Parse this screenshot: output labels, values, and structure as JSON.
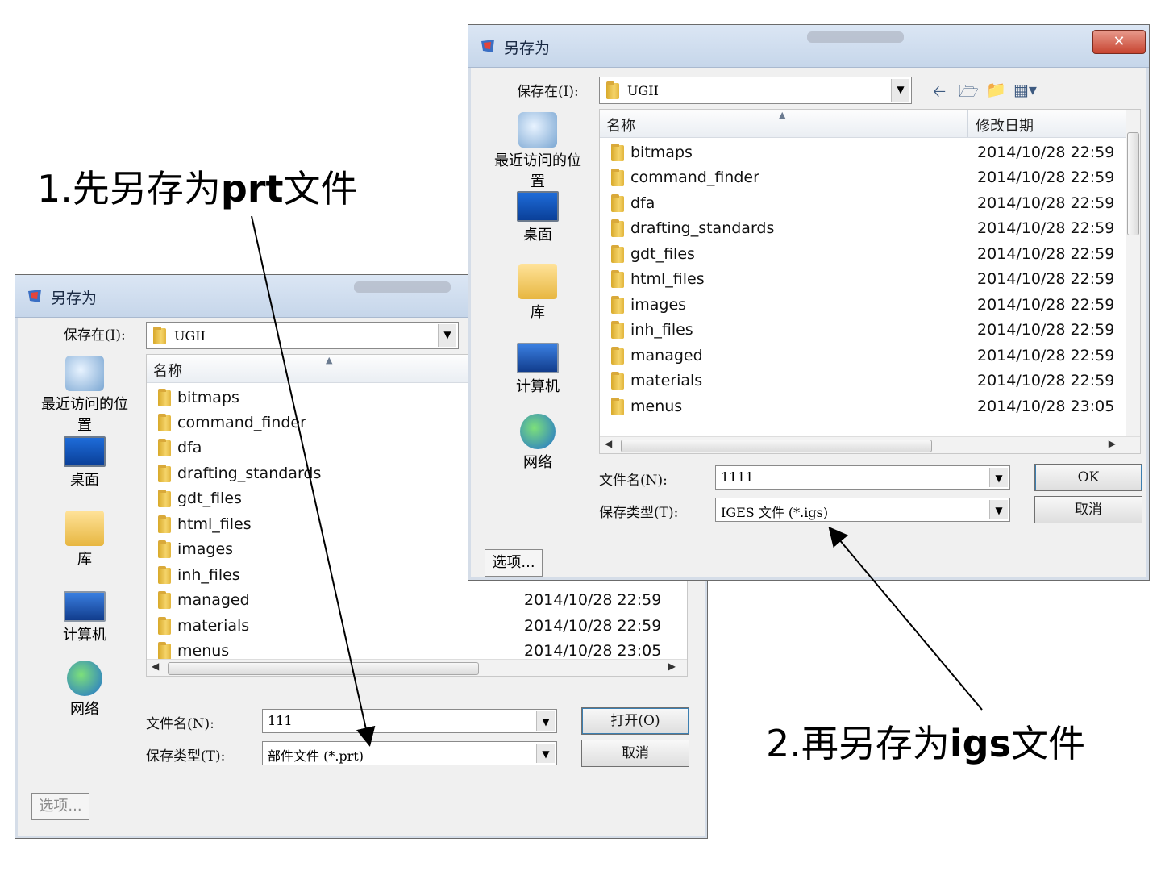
{
  "annotations": {
    "step1": {
      "prefix": "1.先另存为",
      "bold": "prt",
      "suffix": "文件"
    },
    "step2": {
      "prefix": "2.再另存为",
      "bold": "igs",
      "suffix": "文件"
    }
  },
  "dialog_back": {
    "title": "另存为",
    "save_in_label": "保存在(I):",
    "save_in_value": "UGII",
    "places": [
      "最近访问的位置",
      "桌面",
      "库",
      "计算机",
      "网络"
    ],
    "column_name": "名称",
    "files": [
      {
        "name": "bitmaps"
      },
      {
        "name": "command_finder"
      },
      {
        "name": "dfa"
      },
      {
        "name": "drafting_standards"
      },
      {
        "name": "gdt_files"
      },
      {
        "name": "html_files"
      },
      {
        "name": "images"
      },
      {
        "name": "inh_files"
      },
      {
        "name": "managed",
        "date": "2014/10/28 22:59"
      },
      {
        "name": "materials",
        "date": "2014/10/28 22:59"
      },
      {
        "name": "menus",
        "date": "2014/10/28 23:05"
      }
    ],
    "filename_label": "文件名(N):",
    "filename_value": "111",
    "filetype_label": "保存类型(T):",
    "filetype_value": "部件文件 (*.prt)",
    "ok_button": "打开(O)",
    "cancel_button": "取消",
    "options_button": "选项..."
  },
  "dialog_front": {
    "title": "另存为",
    "save_in_label": "保存在(I):",
    "save_in_value": "UGII",
    "places": [
      "最近访问的位置",
      "桌面",
      "库",
      "计算机",
      "网络"
    ],
    "column_name": "名称",
    "column_date": "修改日期",
    "files": [
      {
        "name": "bitmaps",
        "date": "2014/10/28 22:59"
      },
      {
        "name": "command_finder",
        "date": "2014/10/28 22:59"
      },
      {
        "name": "dfa",
        "date": "2014/10/28 22:59"
      },
      {
        "name": "drafting_standards",
        "date": "2014/10/28 22:59"
      },
      {
        "name": "gdt_files",
        "date": "2014/10/28 22:59"
      },
      {
        "name": "html_files",
        "date": "2014/10/28 22:59"
      },
      {
        "name": "images",
        "date": "2014/10/28 22:59"
      },
      {
        "name": "inh_files",
        "date": "2014/10/28 22:59"
      },
      {
        "name": "managed",
        "date": "2014/10/28 22:59"
      },
      {
        "name": "materials",
        "date": "2014/10/28 22:59"
      },
      {
        "name": "menus",
        "date": "2014/10/28 23:05"
      }
    ],
    "filename_label": "文件名(N):",
    "filename_value": "1111",
    "filetype_label": "保存类型(T):",
    "filetype_value": "IGES 文件 (*.igs)",
    "ok_button": "OK",
    "cancel_button": "取消",
    "options_button": "选项..."
  }
}
